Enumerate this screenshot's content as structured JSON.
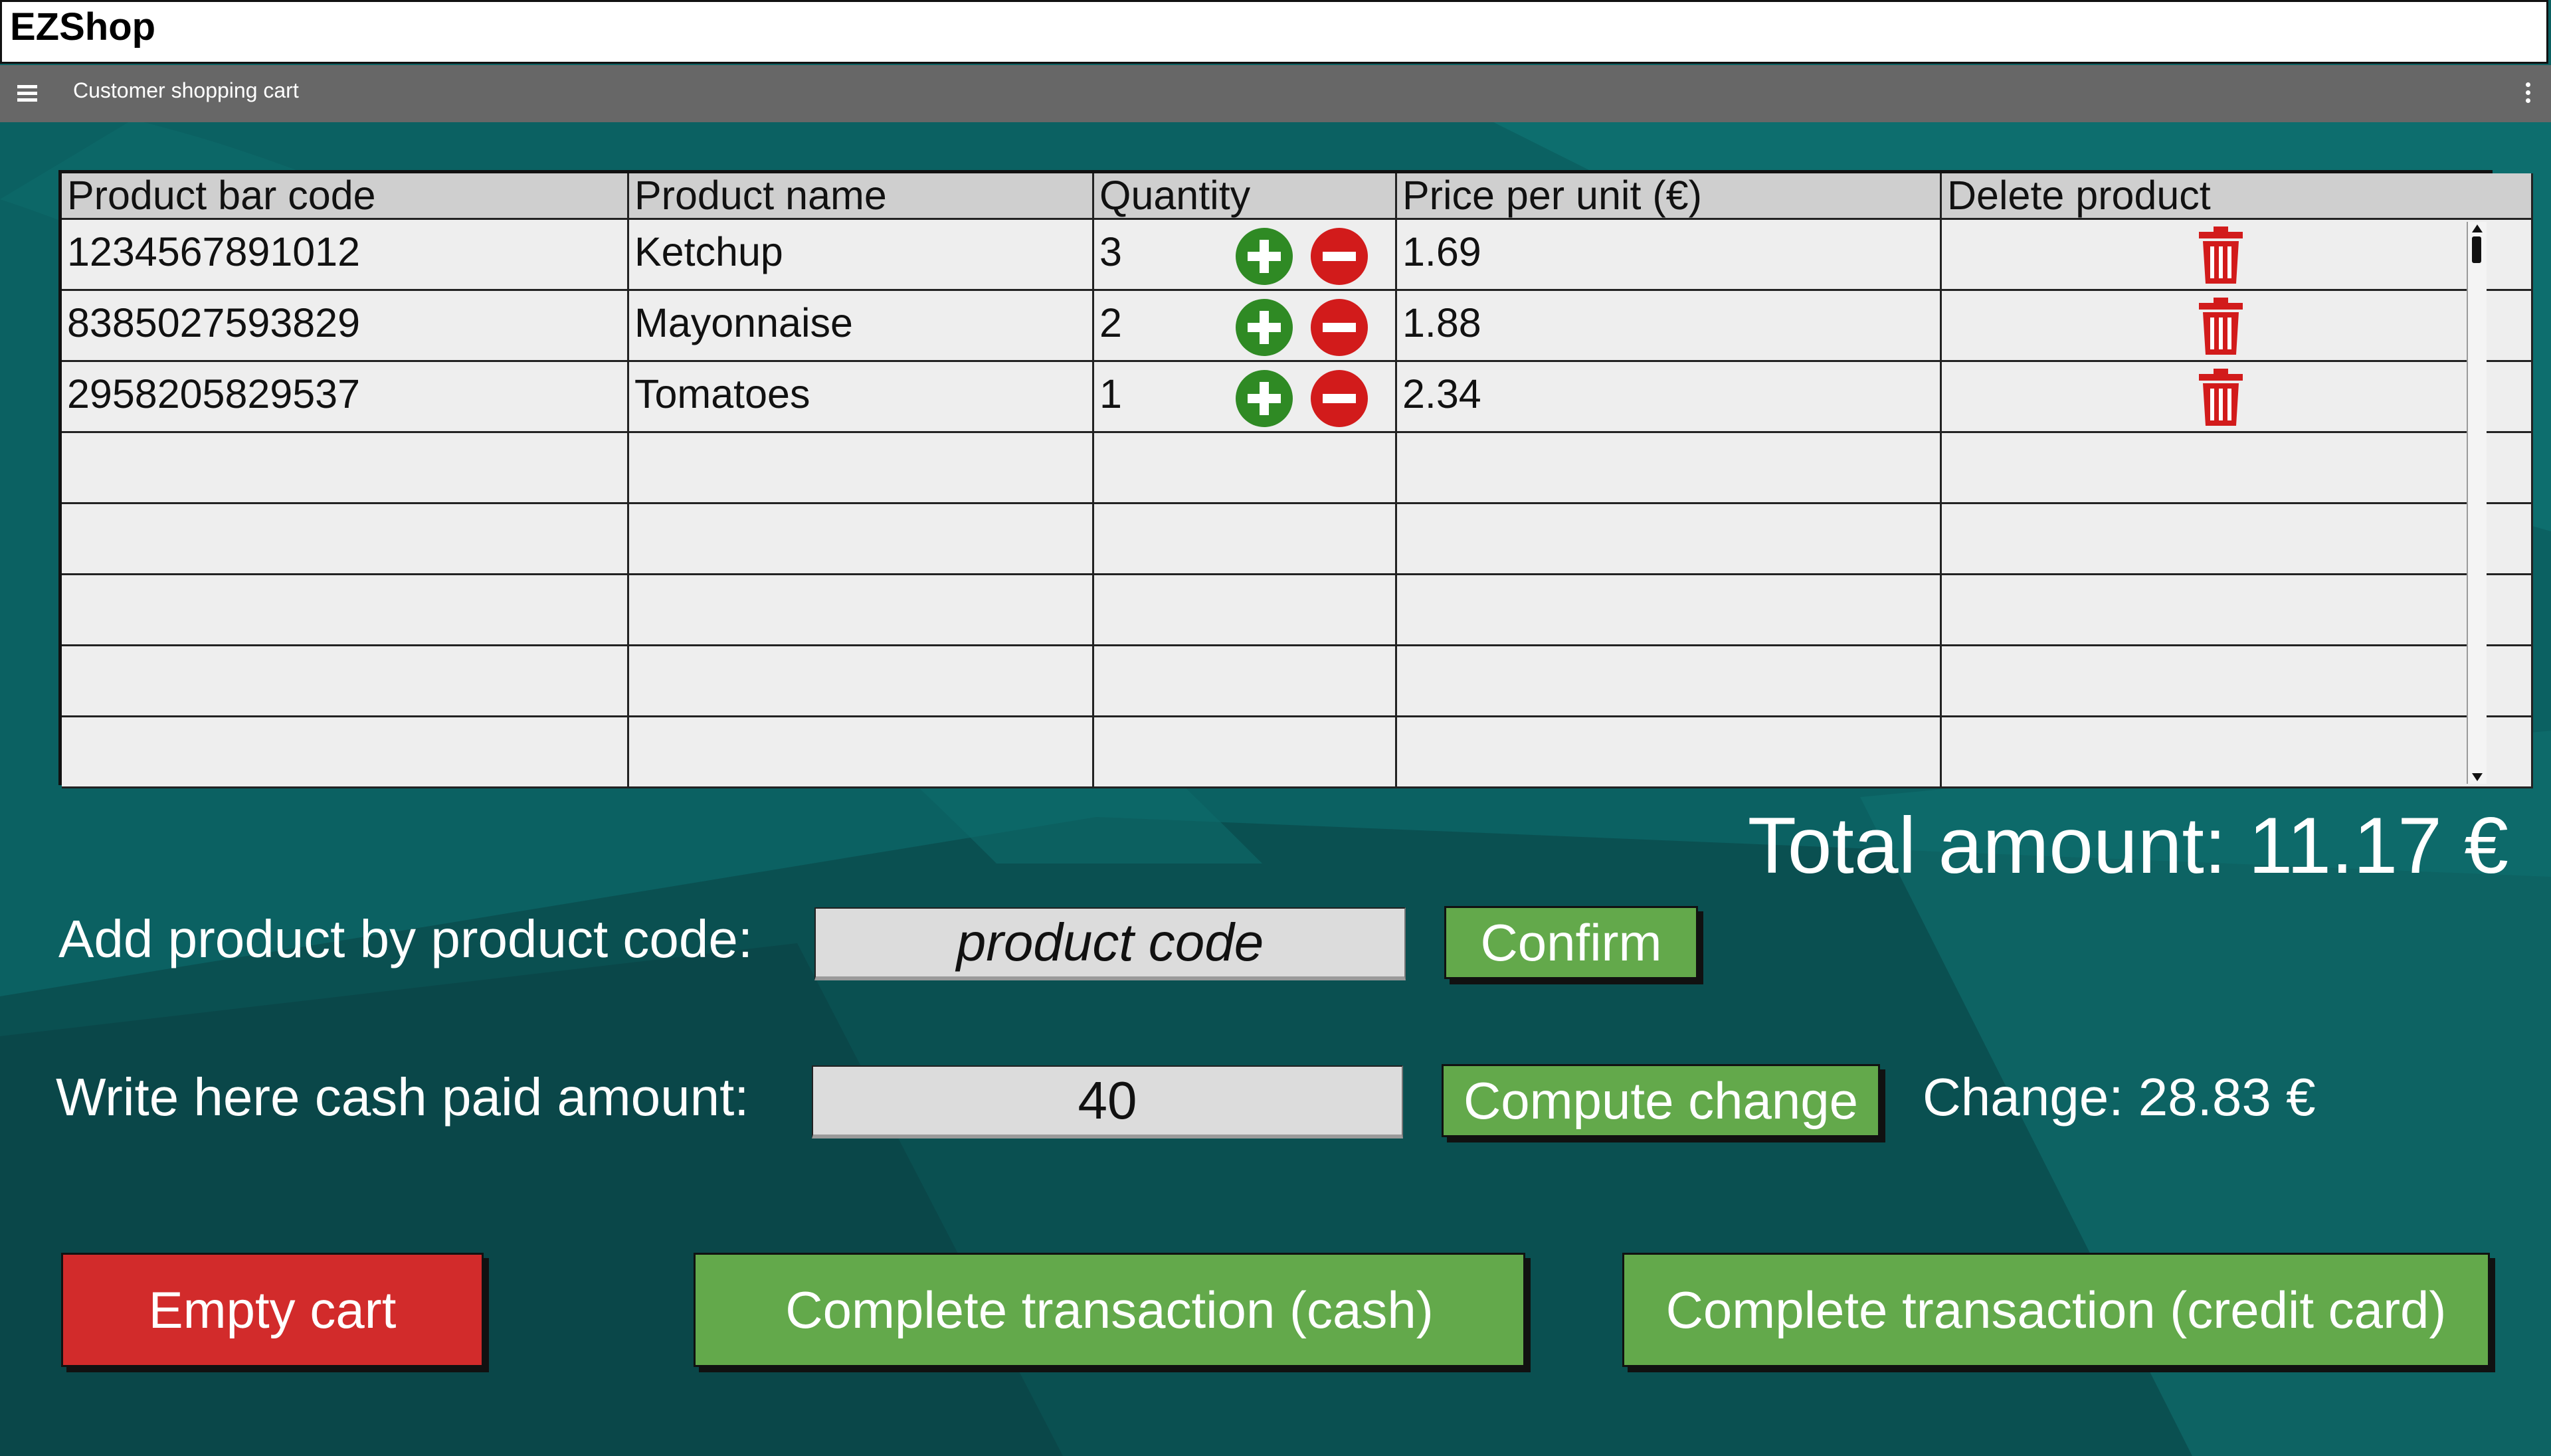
{
  "window": {
    "title": "EZShop"
  },
  "toolbar": {
    "subtitle": "Customer shopping cart",
    "menu_icon": "hamburger-icon",
    "more_icon": "kebab-icon"
  },
  "table": {
    "headers": [
      "Product bar code",
      "Product name",
      "Quantity",
      "Price per unit (€)",
      "Delete product"
    ],
    "rows": [
      {
        "barcode": "1234567891012",
        "name": "Ketchup",
        "quantity": "3",
        "price": "1.69"
      },
      {
        "barcode": "8385027593829",
        "name": "Mayonnaise",
        "quantity": "2",
        "price": "1.88"
      },
      {
        "barcode": "2958205829537",
        "name": "Tomatoes",
        "quantity": "1",
        "price": "2.34"
      }
    ],
    "empty_rows": 5
  },
  "summary": {
    "total_label": "Total amount: 11.17 €"
  },
  "add_product": {
    "label": "Add product by product code:",
    "placeholder": "product code",
    "value": "",
    "confirm_label": "Confirm"
  },
  "cash": {
    "label": "Write here cash paid amount:",
    "value": "40",
    "compute_label": "Compute change",
    "change_label": "Change: 28.83 €"
  },
  "actions": {
    "empty_cart": "Empty cart",
    "complete_cash": "Complete transaction (cash)",
    "complete_card": "Complete transaction (credit card)"
  },
  "colors": {
    "accent_green": "#63a94b",
    "danger_red": "#d22b2b",
    "background": "#0b6162",
    "toolbar": "#676767"
  }
}
